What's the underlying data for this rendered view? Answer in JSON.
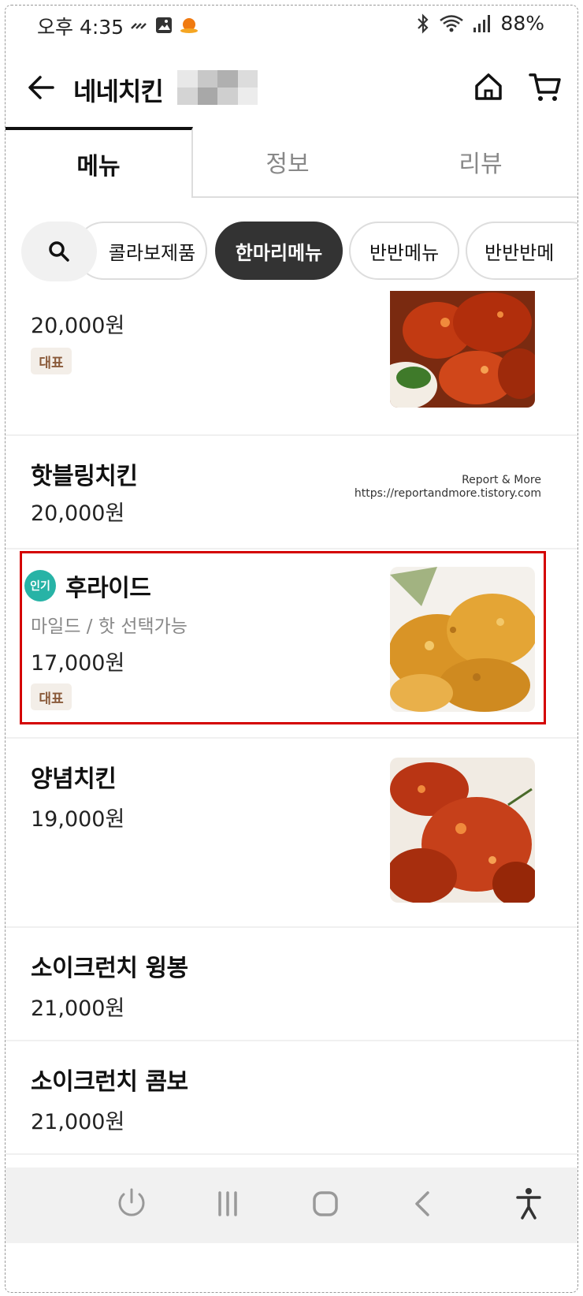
{
  "status_bar": {
    "time": "오후 4:35",
    "battery": "88%",
    "left_icons": [
      "missed-call-icon",
      "gallery-icon",
      "app-notification-icon"
    ],
    "right_icons": [
      "bluetooth-icon",
      "wifi-icon",
      "signal-icon"
    ]
  },
  "header": {
    "store_name": "네네치킨",
    "icons": [
      "back-arrow-icon",
      "home-icon",
      "cart-icon"
    ]
  },
  "tabs": [
    {
      "label": "메뉴",
      "active": true
    },
    {
      "label": "정보",
      "active": false
    },
    {
      "label": "리뷰",
      "active": false
    }
  ],
  "categories": [
    {
      "label": "콜라보제품",
      "active": false
    },
    {
      "label": "한마리메뉴",
      "active": true
    },
    {
      "label": "반반메뉴",
      "active": false
    },
    {
      "label": "반반반메",
      "active": false
    }
  ],
  "watermark": {
    "line1": "Report & More",
    "line2": "https://reportandmore.tistory.com"
  },
  "menu_items": [
    {
      "name": "",
      "price": "20,000원",
      "badge": "대표"
    },
    {
      "name": "핫블링치킨",
      "price": "20,000원"
    },
    {
      "name": "후라이드",
      "popular_badge": "인기",
      "description": "마일드 / 핫 선택가능",
      "price": "17,000원",
      "badge": "대표"
    },
    {
      "name": "양념치킨",
      "price": "19,000원"
    },
    {
      "name": "소이크런치 윙봉",
      "price": "21,000원"
    },
    {
      "name": "소이크런치 콤보",
      "price": "21,000원"
    }
  ],
  "nav_bar": {
    "icons": [
      "power-icon",
      "recent-apps-icon",
      "home-nav-icon",
      "back-nav-icon",
      "accessibility-icon"
    ]
  },
  "colors": {
    "highlight": "#d40000",
    "popular_badge": "#27b3a6",
    "active_chip": "#333333"
  }
}
